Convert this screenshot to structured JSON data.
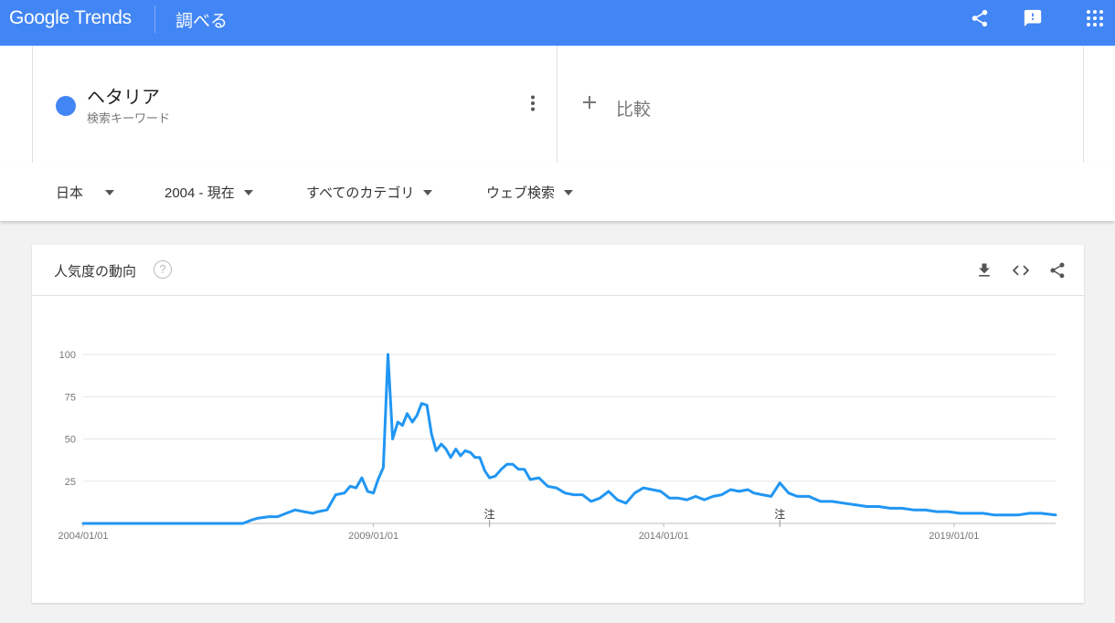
{
  "header": {
    "logo": "Google Trends",
    "section": "調べる",
    "icons": [
      "share-icon",
      "feedback-icon",
      "apps-grid-icon"
    ]
  },
  "search": {
    "term": "ヘタリア",
    "term_type": "検索キーワード",
    "term_color": "#4285f4",
    "compare_label": "比較"
  },
  "filters": {
    "region": "日本",
    "time": "2004 - 現在",
    "category": "すべてのカテゴリ",
    "property": "ウェブ検索"
  },
  "widget": {
    "title": "人気度の動向",
    "help": "?",
    "icons": [
      "download-icon",
      "embed-code-icon",
      "share-icon"
    ]
  },
  "chart_data": {
    "type": "line",
    "title": "",
    "xlabel": "",
    "ylabel": "",
    "ylim": [
      0,
      100
    ],
    "yticks": [
      25,
      50,
      75,
      100
    ],
    "ytick_labels": [
      "25",
      "50",
      "75",
      "100"
    ],
    "xtick_labels": [
      "2004/01/01",
      "2009/01/01",
      "2014/01/01",
      "2019/01/01"
    ],
    "xtick_years": [
      2004,
      2009,
      2014,
      2019
    ],
    "x_range": [
      2004.0,
      2020.75
    ],
    "grid": true,
    "notes": [
      {
        "x": 2011.0,
        "label": "注"
      },
      {
        "x": 2016.0,
        "label": "注"
      }
    ],
    "series": [
      {
        "color": "#2196f3",
        "x": [
          2004.0,
          2005.0,
          2006.0,
          2006.75,
          2006.9,
          2007.0,
          2007.2,
          2007.35,
          2007.5,
          2007.65,
          2007.8,
          2007.95,
          2008.05,
          2008.2,
          2008.35,
          2008.5,
          2008.6,
          2008.7,
          2008.8,
          2008.9,
          2009.0,
          2009.08,
          2009.17,
          2009.25,
          2009.33,
          2009.42,
          2009.5,
          2009.58,
          2009.67,
          2009.75,
          2009.83,
          2009.92,
          2010.0,
          2010.08,
          2010.17,
          2010.25,
          2010.33,
          2010.42,
          2010.5,
          2010.58,
          2010.67,
          2010.75,
          2010.83,
          2010.92,
          2011.0,
          2011.1,
          2011.2,
          2011.3,
          2011.4,
          2011.5,
          2011.6,
          2011.7,
          2011.85,
          2012.0,
          2012.15,
          2012.3,
          2012.45,
          2012.6,
          2012.75,
          2012.9,
          2013.05,
          2013.2,
          2013.35,
          2013.5,
          2013.65,
          2013.8,
          2013.95,
          2014.1,
          2014.25,
          2014.4,
          2014.55,
          2014.7,
          2014.85,
          2015.0,
          2015.15,
          2015.3,
          2015.45,
          2015.55,
          2015.7,
          2015.85,
          2016.0,
          2016.15,
          2016.3,
          2016.5,
          2016.7,
          2016.9,
          2017.1,
          2017.3,
          2017.5,
          2017.7,
          2017.9,
          2018.1,
          2018.3,
          2018.5,
          2018.7,
          2018.9,
          2019.1,
          2019.3,
          2019.5,
          2019.7,
          2019.9,
          2020.1,
          2020.3,
          2020.5,
          2020.75
        ],
        "y": [
          0,
          0,
          0,
          0,
          2,
          3,
          4,
          4,
          6,
          8,
          7,
          6,
          7,
          8,
          17,
          18,
          22,
          21,
          27,
          19,
          18,
          26,
          33,
          100,
          50,
          60,
          58,
          65,
          60,
          64,
          71,
          70,
          53,
          43,
          47,
          44,
          39,
          44,
          40,
          43,
          42,
          39,
          39,
          31,
          27,
          28,
          32,
          35,
          35,
          32,
          32,
          26,
          27,
          22,
          21,
          18,
          17,
          17,
          13,
          15,
          19,
          14,
          12,
          18,
          21,
          20,
          19,
          15,
          15,
          14,
          16,
          14,
          16,
          17,
          20,
          19,
          20,
          18,
          17,
          16,
          24,
          18,
          16,
          16,
          13,
          13,
          12,
          11,
          10,
          10,
          9,
          9,
          8,
          8,
          7,
          7,
          6,
          6,
          6,
          5,
          5,
          5,
          6,
          6,
          5
        ]
      }
    ]
  }
}
